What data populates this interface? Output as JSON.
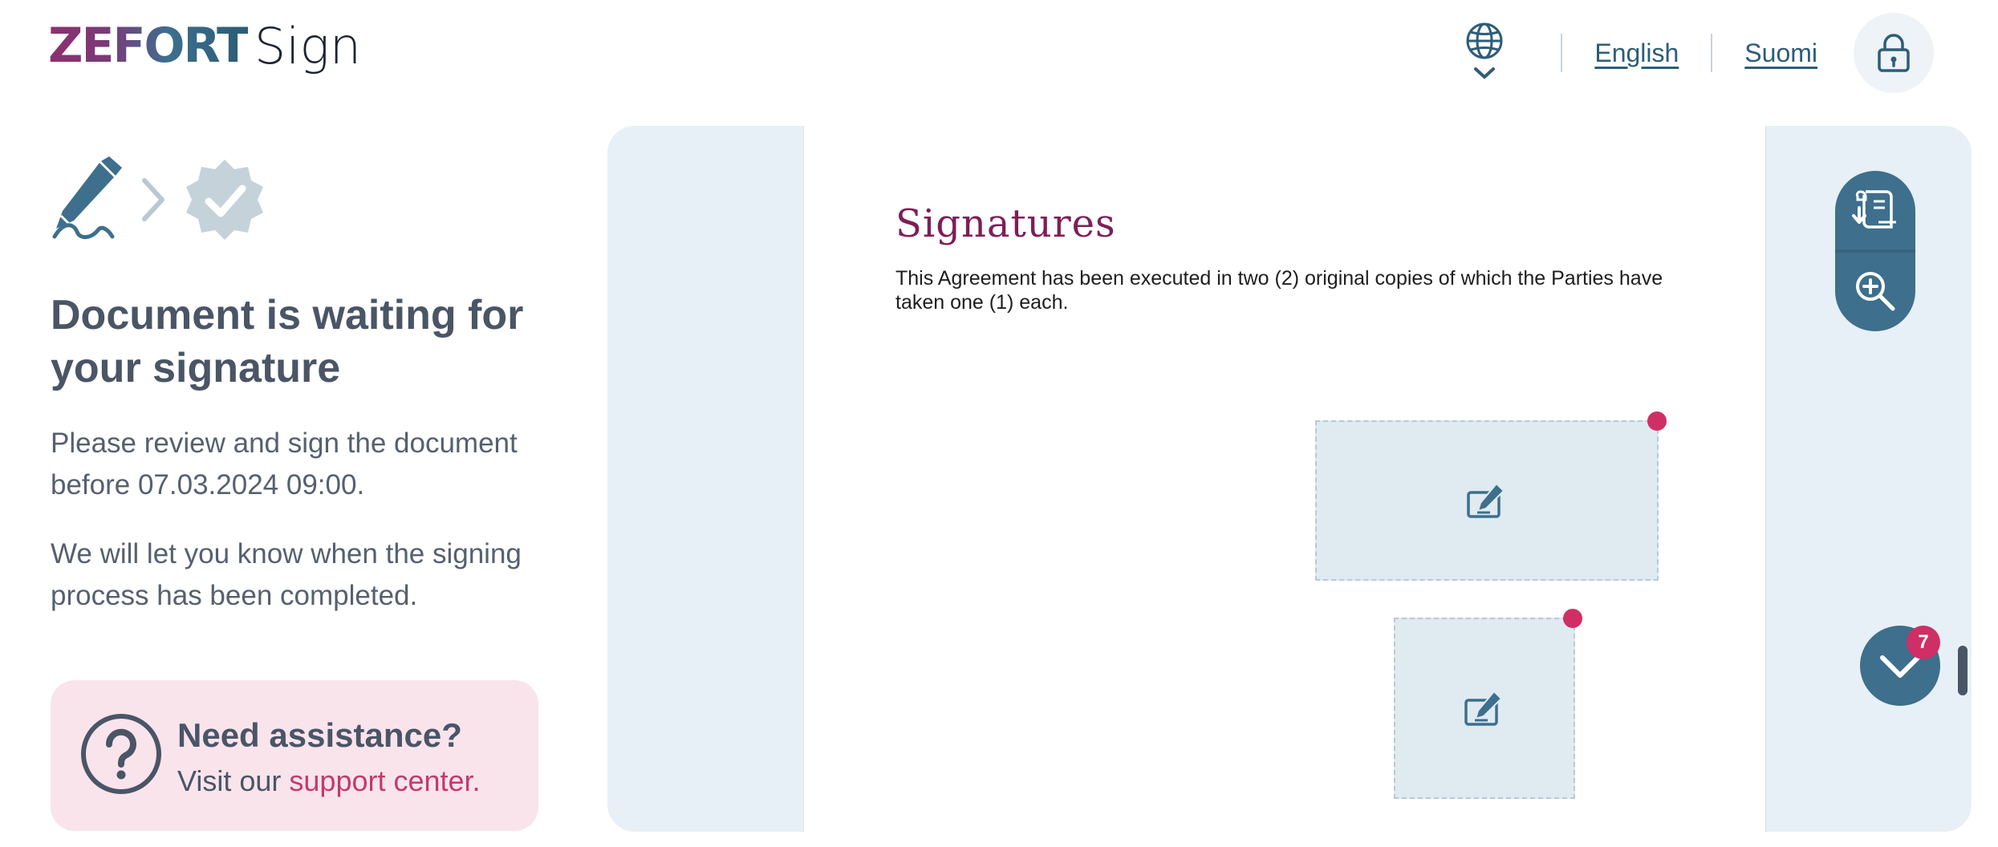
{
  "brand": {
    "logo_main": "ZEFORT",
    "logo_sub": "Sign"
  },
  "header": {
    "languages": [
      "English",
      "Suomi"
    ],
    "globe_icon": "globe-icon",
    "lock_icon": "lock-icon"
  },
  "steps": {
    "sign_icon": "pen-signature-icon",
    "arrow_icon": "chevron-right-icon",
    "done_icon": "verified-badge-icon"
  },
  "status": {
    "title": "Document is waiting for your signature",
    "instruction": "Please review and sign the document before 07.03.2024 09:00.",
    "notify": "We will let you know when the signing process has been completed."
  },
  "assistance": {
    "title": "Need assistance?",
    "text_prefix": "Visit our ",
    "link": "support center."
  },
  "document": {
    "heading": "Signatures",
    "body": "This Agreement has been executed in two (2) original copies of which the Parties have taken one (1) each.",
    "signature_fields": [
      {
        "icon": "sign-pen-icon",
        "required": true
      },
      {
        "icon": "sign-pen-icon",
        "required": true
      }
    ]
  },
  "tools": {
    "download_icon": "download-document-icon",
    "zoom_icon": "zoom-in-icon"
  },
  "navigator": {
    "next_icon": "chevron-down-icon",
    "remaining_count": "7"
  },
  "colors": {
    "primary": "#3e6f8c",
    "accent": "#cf2f65",
    "heading": "#7d1f57",
    "panel_bg": "#e7f0f6",
    "assist_bg": "#f9e4ec"
  }
}
